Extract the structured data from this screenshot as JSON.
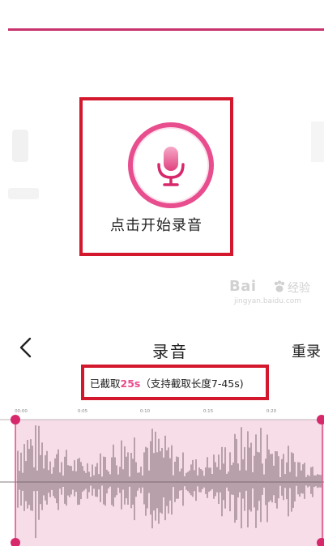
{
  "record": {
    "button_label": "点击开始录音",
    "mic_icon": "microphone-icon"
  },
  "watermark": {
    "main": "Bai",
    "chinese": "经验",
    "url": "jingyan.baidu.com"
  },
  "header": {
    "back_icon": "chevron-left-icon",
    "title": "录音",
    "rerecord_label": "重录"
  },
  "clip": {
    "prefix": "已截取",
    "duration": "25s",
    "hint": "（支持截取长度7-45s)"
  },
  "timeline": {
    "ticks": [
      "00:00",
      "0:05",
      "0:10",
      "0:15",
      "0:20"
    ]
  },
  "colors": {
    "accent": "#e84d8e",
    "highlight_frame": "#d3182d",
    "selection_fill": "#f7dde8",
    "waveform": "#6a5560"
  }
}
